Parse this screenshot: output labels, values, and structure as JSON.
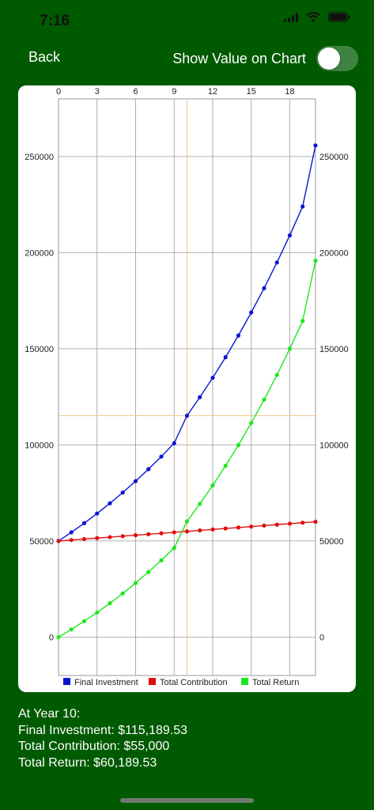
{
  "status_bar": {
    "time": "7:16"
  },
  "nav": {
    "back_label": "Back",
    "toggle_label": "Show Value on Chart",
    "toggle_on": false
  },
  "colors": {
    "background": "#005a00",
    "final_investment": "#0a14d2",
    "total_contribution": "#e01010",
    "total_return": "#1ee61e",
    "crosshair": "#f3c590"
  },
  "chart_data": {
    "type": "line",
    "x": [
      0,
      1,
      2,
      3,
      4,
      5,
      6,
      7,
      8,
      9,
      10,
      11,
      12,
      13,
      14,
      15,
      16,
      17,
      18,
      19,
      20
    ],
    "x_ticks": [
      "0",
      "3",
      "6",
      "9",
      "12",
      "15",
      "18"
    ],
    "x_tick_values": [
      0,
      3,
      6,
      9,
      12,
      15,
      18
    ],
    "y_ticks": [
      "0",
      "50000",
      "100000",
      "150000",
      "200000",
      "250000"
    ],
    "y_tick_values": [
      0,
      50000,
      100000,
      150000,
      200000,
      250000
    ],
    "xlim": [
      0,
      20
    ],
    "ylim": [
      -20000,
      280000
    ],
    "grid": true,
    "legend_position": "bottom",
    "selected_x": 10,
    "selected_y": 115189.53,
    "series": [
      {
        "name": "Final Investment",
        "color": "#0a14d2",
        "values": [
          50000,
          54500,
          59260,
          64290,
          69600,
          75210,
          81120,
          87360,
          93920,
          100840,
          115189.53,
          124800,
          134900,
          145600,
          156900,
          168900,
          181500,
          194900,
          209000,
          224000,
          255800
        ]
      },
      {
        "name": "Total Contribution",
        "color": "#e01010",
        "values": [
          50000,
          50500,
          51000,
          51500,
          52000,
          52500,
          53000,
          53500,
          54000,
          54500,
          55000,
          55500,
          56000,
          56500,
          57000,
          57500,
          58000,
          58500,
          59000,
          59500,
          60000
        ]
      },
      {
        "name": "Total Return",
        "color": "#1ee61e",
        "values": [
          0,
          4000,
          8260,
          12790,
          17600,
          22710,
          28120,
          33860,
          39920,
          46340,
          60189.53,
          69300,
          78900,
          89100,
          99900,
          111400,
          123500,
          136400,
          150000,
          164500,
          195800
        ]
      }
    ]
  },
  "summary": {
    "heading": "At Year 10:",
    "line1": "Final Investment: $115,189.53",
    "line2": "Total Contribution: $55,000",
    "line3": "Total Return: $60,189.53"
  }
}
